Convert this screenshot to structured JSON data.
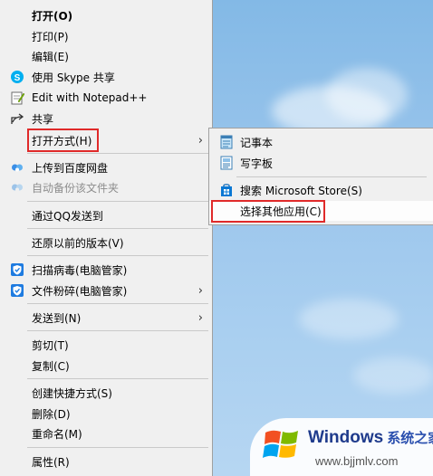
{
  "menu": {
    "items": [
      {
        "label": "打开(O)"
      },
      {
        "label": "打印(P)"
      },
      {
        "label": "编辑(E)"
      },
      {
        "label": "使用 Skype 共享",
        "icon": "skype-icon"
      },
      {
        "label": "Edit with Notepad++",
        "icon": "notepad-plus-plus-icon"
      },
      {
        "label": "共享",
        "icon": "share-icon"
      },
      {
        "label": "打开方式(H)"
      },
      {
        "label": "上传到百度网盘",
        "icon": "baidu-netdisk-icon"
      },
      {
        "label": "自动备份该文件夹",
        "icon": "baidu-netdisk-icon"
      },
      {
        "label": "通过QQ发送到"
      },
      {
        "label": "还原以前的版本(V)"
      },
      {
        "label": "扫描病毒(电脑管家)",
        "icon": "tencent-pc-manager-icon"
      },
      {
        "label": "文件粉碎(电脑管家)",
        "icon": "tencent-pc-manager-icon"
      },
      {
        "label": "发送到(N)"
      },
      {
        "label": "剪切(T)"
      },
      {
        "label": "复制(C)"
      },
      {
        "label": "创建快捷方式(S)"
      },
      {
        "label": "删除(D)"
      },
      {
        "label": "重命名(M)"
      },
      {
        "label": "属性(R)"
      }
    ]
  },
  "submenu": {
    "items": [
      {
        "label": "记事本",
        "icon": "notepad-icon"
      },
      {
        "label": "写字板",
        "icon": "wordpad-icon"
      },
      {
        "label": "搜索 Microsoft Store(S)",
        "icon": "microsoft-store-icon"
      },
      {
        "label": "选择其他应用(C)"
      }
    ]
  },
  "watermark": {
    "brand": "Windows",
    "brand_cn": "系统之家",
    "url": "www.bjjmlv.com"
  },
  "colors": {
    "menu_bg": "#f0f0f0",
    "highlight_border": "#e02a2a",
    "desktop_sky": "#9cc6ec"
  }
}
